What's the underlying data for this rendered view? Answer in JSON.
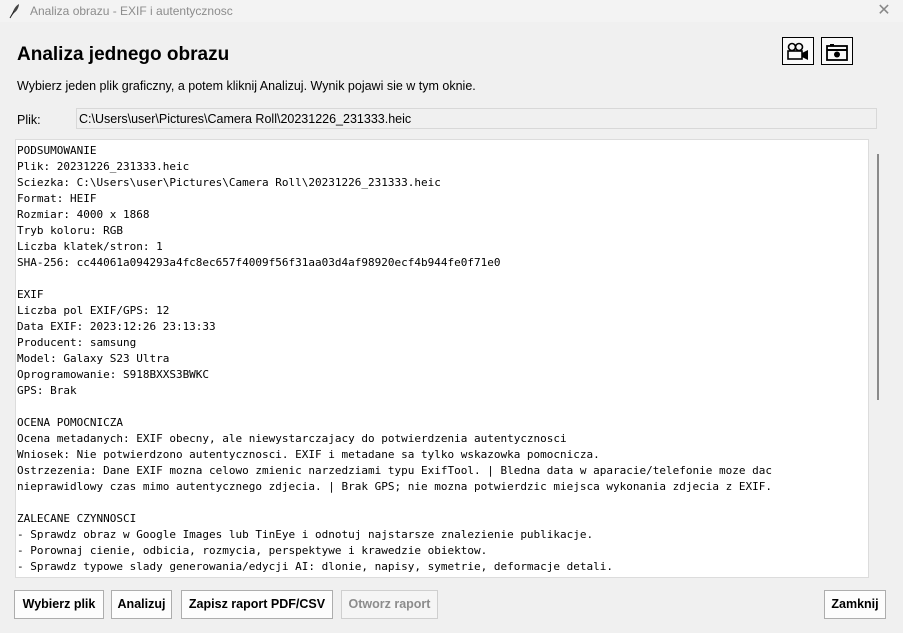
{
  "window": {
    "title": "Analiza obrazu - EXIF i autentycznosc",
    "close_glyph": "✕"
  },
  "header": {
    "title": "Analiza jednego obrazu",
    "icons": [
      "camcorder-icon",
      "camera-icon"
    ]
  },
  "instructions": "Wybierz jeden plik graficzny, a potem kliknij Analizuj. Wynik pojawi sie w tym oknie.",
  "file": {
    "label": "Plik:",
    "value": "C:\\Users\\user\\Pictures\\Camera Roll\\20231226_231333.heic"
  },
  "report": {
    "lines": [
      "PODSUMOWANIE",
      "Plik: 20231226_231333.heic",
      "Sciezka: C:\\Users\\user\\Pictures\\Camera Roll\\20231226_231333.heic",
      "Format: HEIF",
      "Rozmiar: 4000 x 1868",
      "Tryb koloru: RGB",
      "Liczba klatek/stron: 1",
      "SHA-256: cc44061a094293a4fc8ec657f4009f56f31aa03d4af98920ecf4b944fe0f71e0",
      "",
      "EXIF",
      "Liczba pol EXIF/GPS: 12",
      "Data EXIF: 2023:12:26 23:13:33",
      "Producent: samsung",
      "Model: Galaxy S23 Ultra",
      "Oprogramowanie: S918BXXS3BWKC",
      "GPS: Brak",
      "",
      "OCENA POMOCNICZA",
      "Ocena metadanych: EXIF obecny, ale niewystarczajacy do potwierdzenia autentycznosci",
      "Wniosek: Nie potwierdzono autentycznosci. EXIF i metadane sa tylko wskazowka pomocnicza.",
      "Ostrzezenia: Dane EXIF mozna celowo zmienic narzedziami typu ExifTool. | Bledna data w aparacie/telefonie moze dac",
      "nieprawidlowy czas mimo autentycznego zdjecia. | Brak GPS; nie mozna potwierdzic miejsca wykonania zdjecia z EXIF.",
      "",
      "ZALECANE CZYNNOSCI",
      "- Sprawdz obraz w Google Images lub TinEye i odnotuj najstarsze znalezienie publikacje.",
      "- Porownaj cienie, odbicia, rozmycia, perspektywe i krawedzie obiektow.",
      "- Sprawdz typowe slady generowania/edycji AI: dlonie, napisy, symetrie, deformacje detali."
    ]
  },
  "buttons": {
    "choose": "Wybierz plik",
    "analyze": "Analizuj",
    "save": "Zapisz raport PDF/CSV",
    "open": "Otworz raport",
    "close": "Zamknij"
  }
}
